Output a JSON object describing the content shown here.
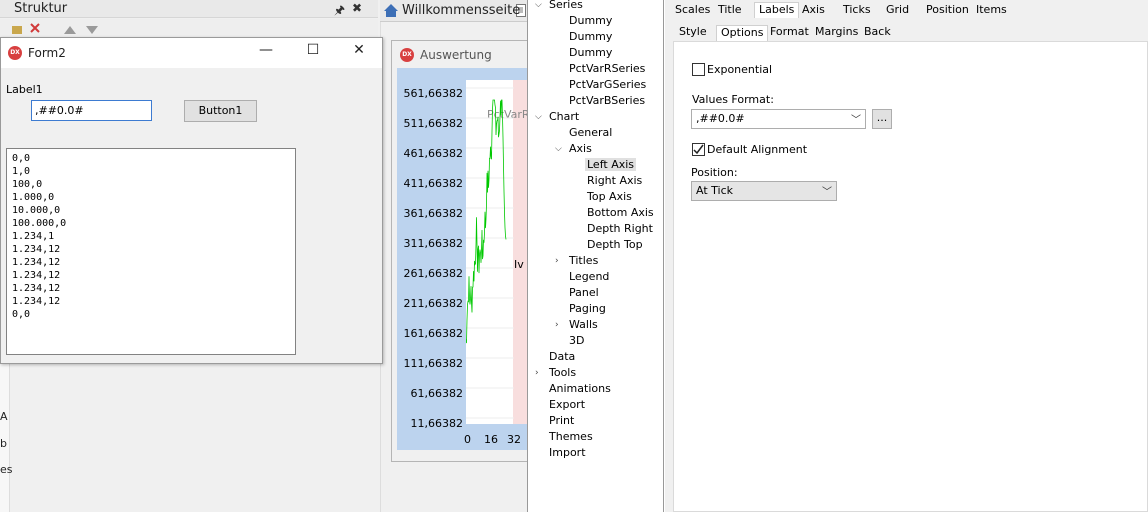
{
  "structure": {
    "title": "Struktur",
    "pin_glyph": "🖈",
    "close_glyph": "✖",
    "side_letters": [
      "A",
      "b",
      "es"
    ]
  },
  "form2": {
    "title": "Form2",
    "logo_text": "DX",
    "minimize_glyph": "—",
    "maximize_glyph": "☐",
    "close_glyph": "✕",
    "label": "Label1",
    "edit_value": ",##0.0#",
    "button_label": "Button1",
    "memo_lines": [
      "0,0",
      "1,0",
      "100,0",
      "1.000,0",
      "10.000,0",
      "100.000,0",
      "1.234,1",
      "1.234,12",
      "1.234,12",
      "1.234,12",
      "1.234,12",
      "1.234,12",
      "0,0"
    ]
  },
  "ide": {
    "welcome_tab": "Willkommensseite"
  },
  "auswertung": {
    "title": "Auswertung",
    "logo_text": "DX",
    "series_label": "PctVarR",
    "partial_label": "Iv",
    "y_ticks": [
      "561,66382",
      "511,66382",
      "461,66382",
      "411,66382",
      "361,66382",
      "311,66382",
      "261,66382",
      "211,66382",
      "161,66382",
      "111,66382",
      "61,66382",
      "11,66382"
    ],
    "x_ticks": [
      "0",
      "16",
      "32"
    ],
    "line_color": "#00c800"
  },
  "tree": {
    "items": [
      {
        "label": "Series",
        "level": 0,
        "arrow": "v"
      },
      {
        "label": "Dummy",
        "level": 1
      },
      {
        "label": "Dummy",
        "level": 1
      },
      {
        "label": "Dummy",
        "level": 1
      },
      {
        "label": "PctVarRSeries",
        "level": 1
      },
      {
        "label": "PctVarGSeries",
        "level": 1
      },
      {
        "label": "PctVarBSeries",
        "level": 1
      },
      {
        "label": "Chart",
        "level": 0,
        "arrow": "v"
      },
      {
        "label": "General",
        "level": 1
      },
      {
        "label": "Axis",
        "level": 1,
        "arrow": "v"
      },
      {
        "label": "Left Axis",
        "level": 2,
        "selected": true
      },
      {
        "label": "Right Axis",
        "level": 2
      },
      {
        "label": "Top Axis",
        "level": 2
      },
      {
        "label": "Bottom Axis",
        "level": 2
      },
      {
        "label": "Depth Right",
        "level": 2
      },
      {
        "label": "Depth Top",
        "level": 2
      },
      {
        "label": "Titles",
        "level": 1,
        "arrow": ">"
      },
      {
        "label": "Legend",
        "level": 1
      },
      {
        "label": "Panel",
        "level": 1
      },
      {
        "label": "Paging",
        "level": 1
      },
      {
        "label": "Walls",
        "level": 1,
        "arrow": ">"
      },
      {
        "label": "3D",
        "level": 1
      },
      {
        "label": "Data",
        "level": 0
      },
      {
        "label": "Tools",
        "level": 0,
        "arrow": ">"
      },
      {
        "label": "Animations",
        "level": 0
      },
      {
        "label": "Export",
        "level": 0
      },
      {
        "label": "Print",
        "level": 0
      },
      {
        "label": "Themes",
        "level": 0
      },
      {
        "label": "Import",
        "level": 0
      }
    ]
  },
  "props": {
    "tabs": [
      "Scales",
      "Title",
      "Labels",
      "Axis",
      "Ticks",
      "Grid",
      "Position",
      "Items"
    ],
    "active_tab": "Labels",
    "subtabs": [
      "Style",
      "Options",
      "Format",
      "Margins",
      "Back"
    ],
    "active_subtab": "Options",
    "exponential_label": "Exponential",
    "exponential_checked": false,
    "values_format_label": "Values Format:",
    "values_format_value": ",##0.0#",
    "dots_button": "...",
    "default_alignment_label": "Default Alignment",
    "default_alignment_checked": true,
    "position_label": "Position:",
    "position_value": "At Tick"
  }
}
